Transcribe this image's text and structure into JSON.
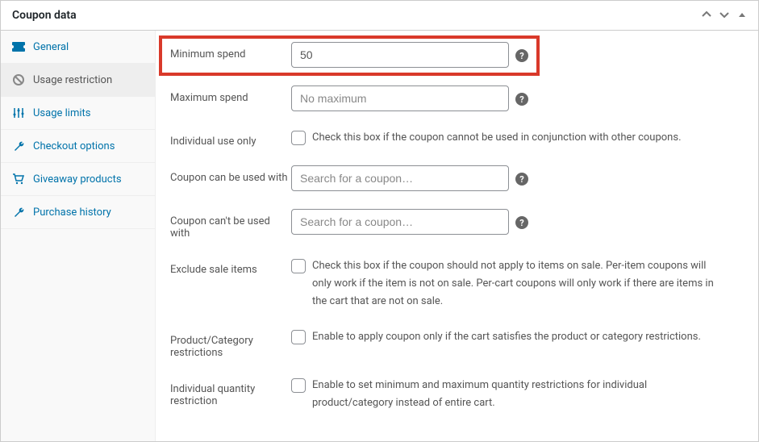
{
  "panel": {
    "title": "Coupon data"
  },
  "sidebar": {
    "items": [
      {
        "label": "General"
      },
      {
        "label": "Usage restriction"
      },
      {
        "label": "Usage limits"
      },
      {
        "label": "Checkout options"
      },
      {
        "label": "Giveaway products"
      },
      {
        "label": "Purchase history"
      }
    ]
  },
  "fields": {
    "min_spend": {
      "label": "Minimum spend",
      "value": "50"
    },
    "max_spend": {
      "label": "Maximum spend",
      "placeholder": "No maximum"
    },
    "individual_use": {
      "label": "Individual use only",
      "help": "Check this box if the coupon cannot be used in conjunction with other coupons."
    },
    "used_with": {
      "label": "Coupon can be used with",
      "placeholder": "Search for a coupon…"
    },
    "cant_used_with": {
      "label": "Coupon can't be used with",
      "placeholder": "Search for a coupon…"
    },
    "exclude_sale": {
      "label": "Exclude sale items",
      "help": "Check this box if the coupon should not apply to items on sale. Per-item coupons will only work if the item is not on sale. Per-cart coupons will only work if there are items in the cart that are not on sale."
    },
    "prod_cat": {
      "label": "Product/Category restrictions",
      "help": "Enable to apply coupon only if the cart satisfies the product or category restrictions."
    },
    "ind_qty": {
      "label": "Individual quantity restriction",
      "help": "Enable to set minimum and maximum quantity restrictions for individual product/category instead of entire cart."
    }
  }
}
